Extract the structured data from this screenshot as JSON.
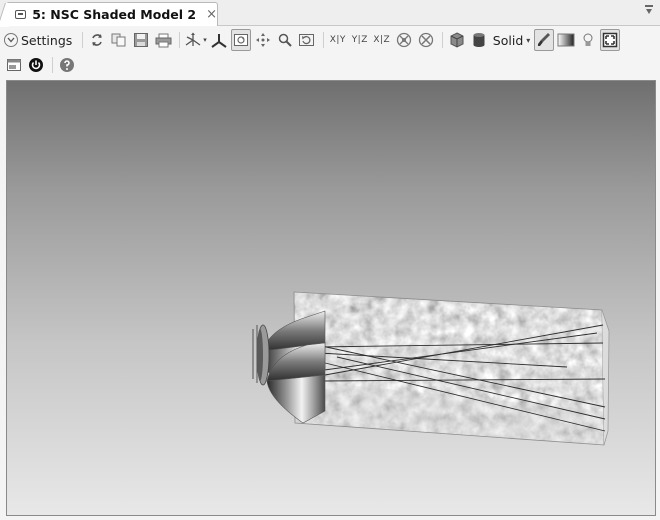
{
  "tab": {
    "title": "5: NSC Shaded Model 2",
    "close_glyph": "×"
  },
  "toolbar": {
    "settings_label": "Settings",
    "xy_label": "X|Y",
    "yz_label": "Y|Z",
    "xz_label": "X|Z",
    "solid_label": "Solid",
    "caret": "▾"
  },
  "icons": [
    "settings-chevron-icon",
    "refresh-icon",
    "copy-icon",
    "save-icon",
    "print-icon",
    "coordinate-axes-icon",
    "axes-orientation-icon",
    "rotate-view-icon",
    "pan-icon",
    "zoom-icon",
    "reset-view-icon",
    "rotate-x-icon",
    "rotate-y-icon",
    "cube-icon",
    "cylinder-icon",
    "brush-icon",
    "gradient-icon",
    "lamp-icon",
    "fit-window-icon",
    "window-icon",
    "power-icon",
    "help-icon"
  ],
  "colors": {
    "accent": "#5a5a5a",
    "viewport_top": "#6f6f6f",
    "viewport_bottom": "#e8e8e8"
  }
}
